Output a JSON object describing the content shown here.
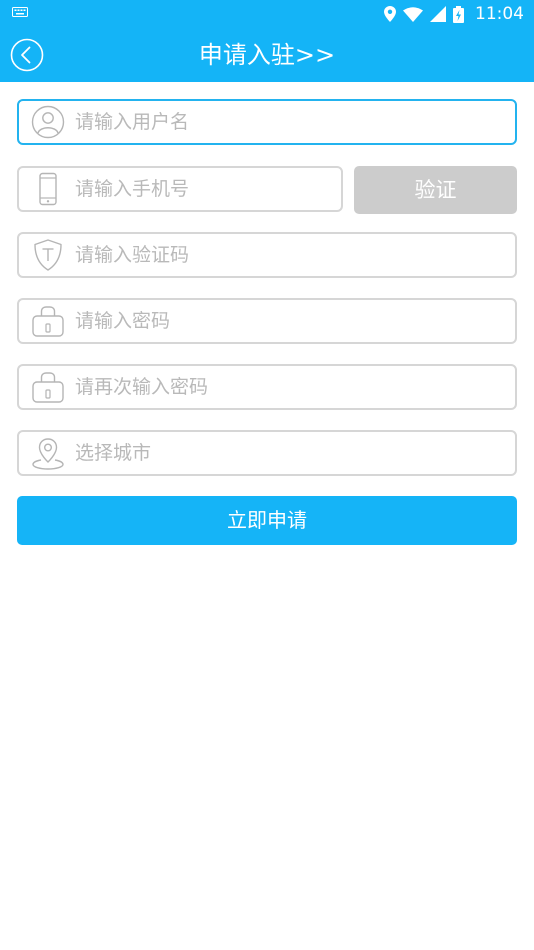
{
  "status_bar": {
    "time": "11:04"
  },
  "header": {
    "title": "申请入驻>>"
  },
  "form": {
    "username_placeholder": "请输入用户名",
    "phone_placeholder": "请输入手机号",
    "code_placeholder": "请输入验证码",
    "password_placeholder": "请输入密码",
    "confirm_password_placeholder": "请再次输入密码",
    "city_placeholder": "选择城市",
    "verify_label": "验证",
    "submit_label": "立即申请"
  },
  "colors": {
    "primary": "#14b4f7",
    "focus_border": "#23b3ef",
    "disabled_button": "#cccccc",
    "placeholder": "#b9b9b9"
  }
}
